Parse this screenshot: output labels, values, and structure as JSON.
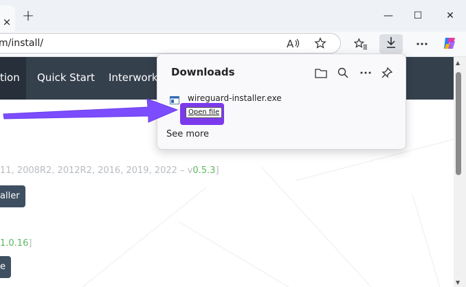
{
  "browser": {
    "url": "m/install/",
    "tab_close_glyph": "×",
    "new_tab_glyph": "+"
  },
  "window_controls": {
    "minimize": "—",
    "maximize": "☐",
    "close": "✕"
  },
  "toolbar_icons": [
    "read-aloud-icon",
    "favorite-star-icon",
    "favorites-list-icon",
    "download-icon",
    "more-icon",
    "copilot-icon"
  ],
  "website": {
    "nav": [
      "tion",
      "Quick Start",
      "Interworki"
    ],
    "os_line_prefix": "11, 2008R2, 2012R2, 2016, 2019, 2022 – v",
    "os_line_version": "0.5.3",
    "os_line_suffix": "]",
    "installer_button": "aller",
    "version_line_version": "1.0.16",
    "version_line_suffix": "]",
    "second_button": "e"
  },
  "downloads_panel": {
    "title": "Downloads",
    "file_name": "wireguard-installer.exe",
    "open_file": "Open file",
    "see_more": "See more"
  },
  "colors": {
    "nav_bg": "#35404d",
    "highlight": "#7c3aed",
    "arrow": "#7c4dff",
    "version_green": "#5cb85c"
  }
}
